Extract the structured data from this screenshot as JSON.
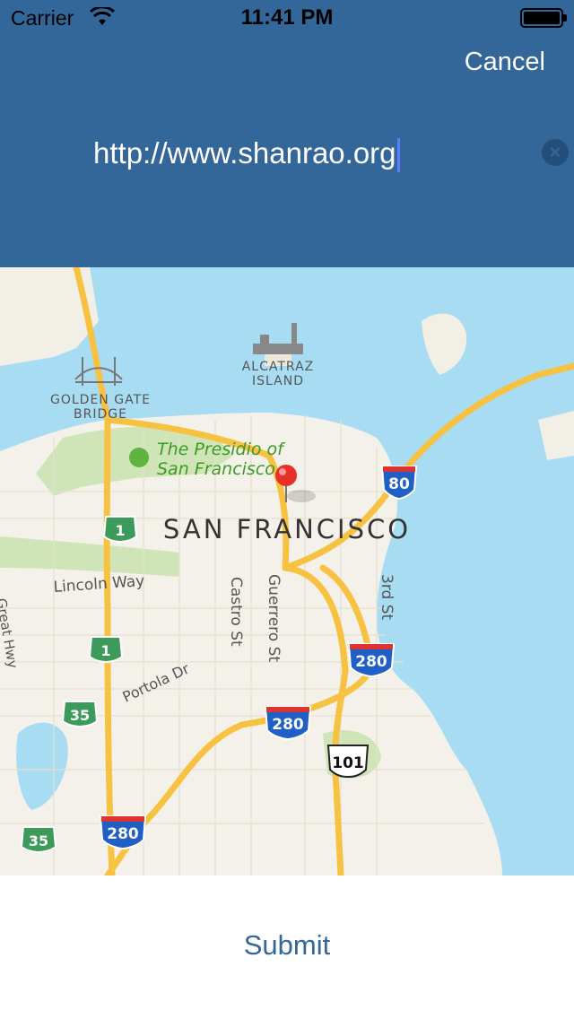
{
  "status_bar": {
    "carrier": "Carrier",
    "time": "11:41 PM"
  },
  "header": {
    "cancel_label": "Cancel",
    "url_value": "http://www.shanrao.org",
    "clear_icon": "clear-text-icon"
  },
  "map": {
    "labels": {
      "golden_gate_1": "GOLDEN GATE",
      "golden_gate_2": "BRIDGE",
      "alcatraz_1": "ALCATRAZ",
      "alcatraz_2": "ISLAND",
      "presidio_1": "The Presidio of",
      "presidio_2": "San Francisco",
      "city": "SAN FRANCISCO",
      "lincoln": "Lincoln Way",
      "castro": "Castro St",
      "guerrero": "Guerrero St",
      "third": "3rd St",
      "portola": "Portola Dr",
      "great_hwy": "Great Hwy"
    },
    "shields": {
      "i80": "80",
      "i280_a": "280",
      "i280_b": "280",
      "i280_c": "280",
      "us101": "101",
      "ca1_a": "1",
      "ca1_b": "1",
      "ca35_a": "35",
      "ca35_b": "35"
    },
    "pin_color": "#e8302b"
  },
  "footer": {
    "submit_label": "Submit"
  },
  "colors": {
    "header": "#336699",
    "water": "#a8dcf2",
    "land": "#f4f1ea",
    "park": "#cfe5b7",
    "highway": "#f7c242"
  }
}
